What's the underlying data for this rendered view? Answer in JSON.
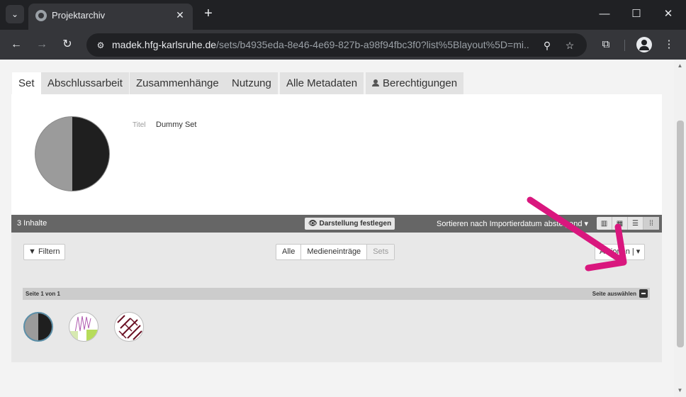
{
  "browser": {
    "tab_title": "Projektarchiv",
    "url_host": "madek.hfg-karlsruhe.de",
    "url_path": "/sets/b4935eda-8e46-4e69-827b-a98f94fbc3f0?list%5Blayout%5D=mi..."
  },
  "tabs": [
    {
      "label": "Set"
    },
    {
      "label": "Abschlussarbeit"
    },
    {
      "label": "Zusammenhänge"
    },
    {
      "label": "Nutzung"
    },
    {
      "label": "Alle Metadaten"
    },
    {
      "label": "Berechtigungen"
    }
  ],
  "meta": {
    "title_label": "Titel",
    "title_value": "Dummy Set"
  },
  "listbar": {
    "count": "3 Inhalte",
    "fix_layout": "Darstellung festlegen",
    "sort": "Sortieren nach Importierdatum absteigend",
    "sort_caret": "▾"
  },
  "filter": {
    "filter_label": "Filtern",
    "types": [
      "Alle",
      "Medieneinträge",
      "Sets"
    ],
    "actions_label": "Aktionen",
    "actions_caret": "▾"
  },
  "pagination": {
    "page_info": "Seite 1 von 1",
    "select_label": "Seite auswählen"
  },
  "colors": {
    "annotation_arrow": "#d9177e",
    "listbar": "#666666"
  }
}
